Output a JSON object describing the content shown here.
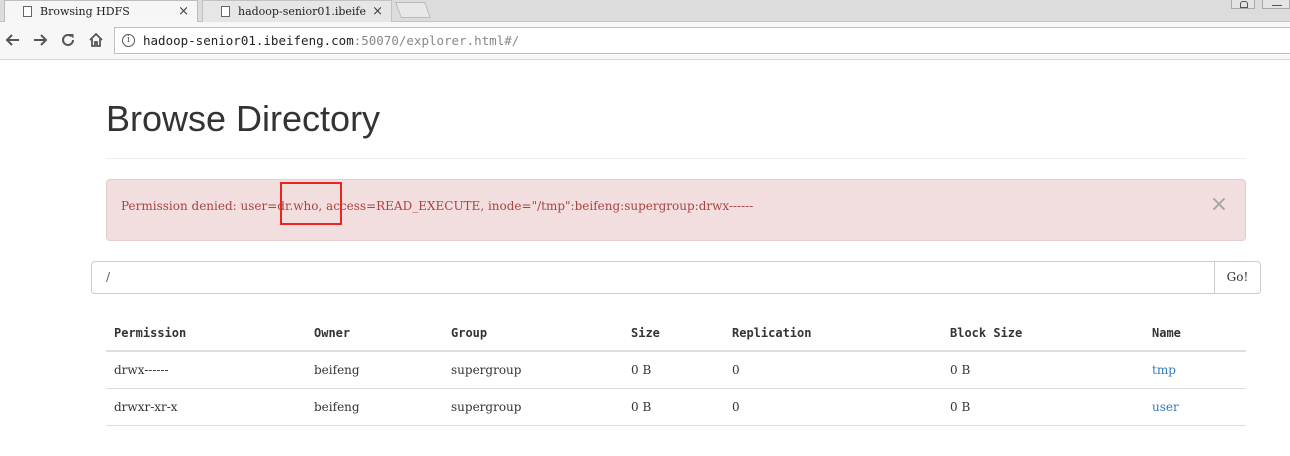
{
  "browser": {
    "tabs": [
      {
        "label": "Browsing HDFS",
        "close": "×"
      },
      {
        "label": "hadoop-senior01.ibeife",
        "close": "×"
      }
    ],
    "url_host": "hadoop-senior01.ibeifeng.com",
    "url_rest": ":50070/explorer.html#/"
  },
  "page": {
    "title": "Browse Directory",
    "alert_text": "Permission denied: user=dr.who, access=READ_EXECUTE, inode=\"/tmp\":beifeng:supergroup:drwx------",
    "alert_close": "×",
    "directory_value": "/",
    "go_label": "Go!"
  },
  "table": {
    "headers": [
      "Permission",
      "Owner",
      "Group",
      "Size",
      "Replication",
      "Block Size",
      "Name"
    ],
    "rows": [
      {
        "permission": "drwx------",
        "owner": "beifeng",
        "group": "supergroup",
        "size": "0 B",
        "replication": "0",
        "block_size": "0 B",
        "name": "tmp"
      },
      {
        "permission": "drwxr-xr-x",
        "owner": "beifeng",
        "group": "supergroup",
        "size": "0 B",
        "replication": "0",
        "block_size": "0 B",
        "name": "user"
      }
    ]
  },
  "icons": [
    "page-icon",
    "close-icon",
    "back-icon",
    "forward-icon",
    "reload-icon",
    "home-icon",
    "info-icon"
  ],
  "colors": {
    "alert_bg": "#f2dede",
    "alert_text": "#a94442",
    "link": "#337ab7",
    "highlight": "#e8251f"
  }
}
